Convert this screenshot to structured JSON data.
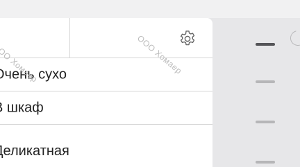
{
  "watermark": {
    "text": "ООО Хомаер"
  },
  "header": {
    "settings_icon": "gear-icon"
  },
  "options": [
    {
      "label": "Очень сухо"
    },
    {
      "label": "В шкаф"
    },
    {
      "label": "Деликатная"
    }
  ],
  "side_indicators": {
    "count": 4,
    "active_index": 0
  },
  "colors": {
    "background": "#e7e7e9",
    "panel": "#ffffff",
    "divider": "#d6d6d6",
    "text": "#222222",
    "indicator_active": "#555558",
    "indicator_inactive": "#b6b6b8",
    "watermark": "#bcbcbc"
  }
}
